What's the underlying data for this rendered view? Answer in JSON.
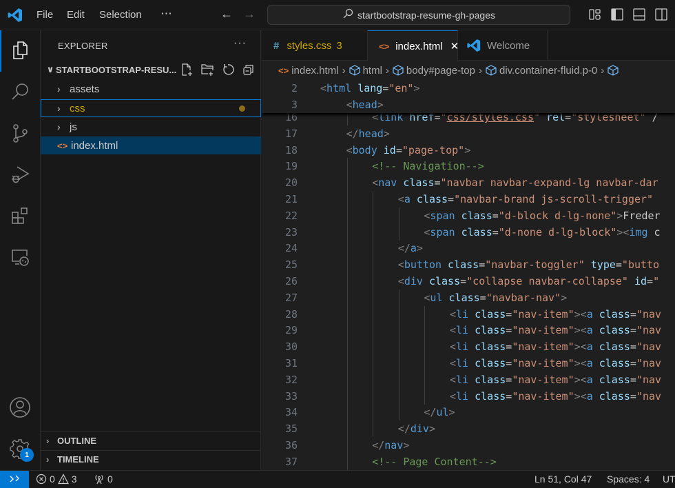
{
  "titlebar": {
    "menus": [
      "File",
      "Edit",
      "Selection",
      "⋯"
    ],
    "search_text": "startbootstrap-resume-gh-pages",
    "icons": [
      "vscode-logo",
      "arrow-left",
      "arrow-right",
      "customize-layout",
      "toggle-primary-sidebar",
      "toggle-panel",
      "toggle-secondary-sidebar"
    ]
  },
  "activity_bar": {
    "items": [
      "explorer",
      "search",
      "source-control",
      "run-and-debug",
      "extensions",
      "remote-explorer"
    ],
    "bottom": [
      "accounts",
      "manage"
    ],
    "manage_badge": "1",
    "accent": "#0078d4"
  },
  "sidebar": {
    "title": "EXPLORER",
    "more": "···",
    "folder": "STARTBOOTSTRAP-RESU...",
    "folder_actions": [
      "new-file",
      "new-folder",
      "refresh",
      "collapse-all"
    ],
    "tree": [
      {
        "label": "assets",
        "type": "folder"
      },
      {
        "label": "css",
        "type": "folder",
        "modified": true
      },
      {
        "label": "js",
        "type": "folder"
      },
      {
        "label": "index.html",
        "type": "file",
        "selected": true
      }
    ],
    "sections": [
      "OUTLINE",
      "TIMELINE"
    ]
  },
  "tabs": [
    {
      "icon": "#",
      "label": "styles.css",
      "badge": "3",
      "color": "#cca700"
    },
    {
      "icon": "<>",
      "label": "index.html",
      "active": true,
      "close": "✕"
    },
    {
      "icon": "vscode",
      "label": "Welcome"
    }
  ],
  "breadcrumb": [
    "index.html",
    "html",
    "body#page-top",
    "div.container-fluid.p-0",
    ""
  ],
  "sticky_lines": [
    {
      "n": "2",
      "tokens": [
        [
          "t",
          "<"
        ],
        [
          "tn",
          "html"
        ],
        [
          "tx",
          " "
        ],
        [
          "at",
          "lang"
        ],
        [
          "tx",
          "="
        ],
        [
          "av",
          "\"en\""
        ],
        [
          "t",
          ">"
        ]
      ],
      "indent": 0
    },
    {
      "n": "3",
      "tokens": [
        [
          "t",
          "<"
        ],
        [
          "tn",
          "head"
        ],
        [
          "t",
          ">"
        ]
      ],
      "indent": 1
    }
  ],
  "lines": [
    {
      "n": "16",
      "indent": 2,
      "tokens": [
        [
          "t",
          "<"
        ],
        [
          "tn",
          "link"
        ],
        [
          "tx",
          " "
        ],
        [
          "at",
          "href"
        ],
        [
          "tx",
          "="
        ],
        [
          "av",
          "\""
        ],
        [
          "av ul",
          "css/styles.css"
        ],
        [
          "av",
          "\""
        ],
        [
          "tx",
          " "
        ],
        [
          "at",
          "rel"
        ],
        [
          "tx",
          "="
        ],
        [
          "av",
          "\"stylesheet\""
        ],
        [
          "tx",
          " /"
        ]
      ]
    },
    {
      "n": "17",
      "indent": 1,
      "tokens": [
        [
          "t",
          "</"
        ],
        [
          "tn",
          "head"
        ],
        [
          "t",
          ">"
        ]
      ]
    },
    {
      "n": "18",
      "indent": 1,
      "tokens": [
        [
          "t",
          "<"
        ],
        [
          "tn",
          "body"
        ],
        [
          "tx",
          " "
        ],
        [
          "at",
          "id"
        ],
        [
          "tx",
          "="
        ],
        [
          "av",
          "\"page-top\""
        ],
        [
          "t",
          ">"
        ]
      ]
    },
    {
      "n": "19",
      "indent": 2,
      "tokens": [
        [
          "cm",
          "<!-- Navigation-->"
        ]
      ]
    },
    {
      "n": "20",
      "indent": 2,
      "tokens": [
        [
          "t",
          "<"
        ],
        [
          "tn",
          "nav"
        ],
        [
          "tx",
          " "
        ],
        [
          "at",
          "class"
        ],
        [
          "tx",
          "="
        ],
        [
          "av",
          "\"navbar navbar-expand-lg navbar-dar"
        ]
      ]
    },
    {
      "n": "21",
      "indent": 3,
      "tokens": [
        [
          "t",
          "<"
        ],
        [
          "tn",
          "a"
        ],
        [
          "tx",
          " "
        ],
        [
          "at",
          "class"
        ],
        [
          "tx",
          "="
        ],
        [
          "av",
          "\"navbar-brand js-scroll-trigger\""
        ]
      ]
    },
    {
      "n": "22",
      "indent": 4,
      "tokens": [
        [
          "t",
          "<"
        ],
        [
          "tn",
          "span"
        ],
        [
          "tx",
          " "
        ],
        [
          "at",
          "class"
        ],
        [
          "tx",
          "="
        ],
        [
          "av",
          "\"d-block d-lg-none\""
        ],
        [
          "t",
          ">"
        ],
        [
          "tx",
          "Freder"
        ]
      ]
    },
    {
      "n": "23",
      "indent": 4,
      "tokens": [
        [
          "t",
          "<"
        ],
        [
          "tn",
          "span"
        ],
        [
          "tx",
          " "
        ],
        [
          "at",
          "class"
        ],
        [
          "tx",
          "="
        ],
        [
          "av",
          "\"d-none d-lg-block\""
        ],
        [
          "t",
          ">"
        ],
        [
          "t",
          "<"
        ],
        [
          "tn",
          "img"
        ],
        [
          "tx",
          " c"
        ]
      ]
    },
    {
      "n": "24",
      "indent": 3,
      "tokens": [
        [
          "t",
          "</"
        ],
        [
          "tn",
          "a"
        ],
        [
          "t",
          ">"
        ]
      ]
    },
    {
      "n": "25",
      "indent": 3,
      "tokens": [
        [
          "t",
          "<"
        ],
        [
          "tn",
          "button"
        ],
        [
          "tx",
          " "
        ],
        [
          "at",
          "class"
        ],
        [
          "tx",
          "="
        ],
        [
          "av",
          "\"navbar-toggler\""
        ],
        [
          "tx",
          " "
        ],
        [
          "at",
          "type"
        ],
        [
          "tx",
          "="
        ],
        [
          "av",
          "\"butto"
        ]
      ]
    },
    {
      "n": "26",
      "indent": 3,
      "tokens": [
        [
          "t",
          "<"
        ],
        [
          "tn",
          "div"
        ],
        [
          "tx",
          " "
        ],
        [
          "at",
          "class"
        ],
        [
          "tx",
          "="
        ],
        [
          "av",
          "\"collapse navbar-collapse\""
        ],
        [
          "tx",
          " "
        ],
        [
          "at",
          "id"
        ],
        [
          "tx",
          "="
        ],
        [
          "av",
          "\""
        ]
      ]
    },
    {
      "n": "27",
      "indent": 4,
      "tokens": [
        [
          "t",
          "<"
        ],
        [
          "tn",
          "ul"
        ],
        [
          "tx",
          " "
        ],
        [
          "at",
          "class"
        ],
        [
          "tx",
          "="
        ],
        [
          "av",
          "\"navbar-nav\""
        ],
        [
          "t",
          ">"
        ]
      ]
    },
    {
      "n": "28",
      "indent": 5,
      "tokens": [
        [
          "t",
          "<"
        ],
        [
          "tn",
          "li"
        ],
        [
          "tx",
          " "
        ],
        [
          "at",
          "class"
        ],
        [
          "tx",
          "="
        ],
        [
          "av",
          "\"nav-item\""
        ],
        [
          "t",
          ">"
        ],
        [
          "t",
          "<"
        ],
        [
          "tn",
          "a"
        ],
        [
          "tx",
          " "
        ],
        [
          "at",
          "class"
        ],
        [
          "tx",
          "="
        ],
        [
          "av",
          "\"nav"
        ]
      ]
    },
    {
      "n": "29",
      "indent": 5,
      "tokens": [
        [
          "t",
          "<"
        ],
        [
          "tn",
          "li"
        ],
        [
          "tx",
          " "
        ],
        [
          "at",
          "class"
        ],
        [
          "tx",
          "="
        ],
        [
          "av",
          "\"nav-item\""
        ],
        [
          "t",
          ">"
        ],
        [
          "t",
          "<"
        ],
        [
          "tn",
          "a"
        ],
        [
          "tx",
          " "
        ],
        [
          "at",
          "class"
        ],
        [
          "tx",
          "="
        ],
        [
          "av",
          "\"nav"
        ]
      ]
    },
    {
      "n": "30",
      "indent": 5,
      "tokens": [
        [
          "t",
          "<"
        ],
        [
          "tn",
          "li"
        ],
        [
          "tx",
          " "
        ],
        [
          "at",
          "class"
        ],
        [
          "tx",
          "="
        ],
        [
          "av",
          "\"nav-item\""
        ],
        [
          "t",
          ">"
        ],
        [
          "t",
          "<"
        ],
        [
          "tn",
          "a"
        ],
        [
          "tx",
          " "
        ],
        [
          "at",
          "class"
        ],
        [
          "tx",
          "="
        ],
        [
          "av",
          "\"nav"
        ]
      ]
    },
    {
      "n": "31",
      "indent": 5,
      "tokens": [
        [
          "t",
          "<"
        ],
        [
          "tn",
          "li"
        ],
        [
          "tx",
          " "
        ],
        [
          "at",
          "class"
        ],
        [
          "tx",
          "="
        ],
        [
          "av",
          "\"nav-item\""
        ],
        [
          "t",
          ">"
        ],
        [
          "t",
          "<"
        ],
        [
          "tn",
          "a"
        ],
        [
          "tx",
          " "
        ],
        [
          "at",
          "class"
        ],
        [
          "tx",
          "="
        ],
        [
          "av",
          "\"nav"
        ]
      ]
    },
    {
      "n": "32",
      "indent": 5,
      "tokens": [
        [
          "t",
          "<"
        ],
        [
          "tn",
          "li"
        ],
        [
          "tx",
          " "
        ],
        [
          "at",
          "class"
        ],
        [
          "tx",
          "="
        ],
        [
          "av",
          "\"nav-item\""
        ],
        [
          "t",
          ">"
        ],
        [
          "t",
          "<"
        ],
        [
          "tn",
          "a"
        ],
        [
          "tx",
          " "
        ],
        [
          "at",
          "class"
        ],
        [
          "tx",
          "="
        ],
        [
          "av",
          "\"nav"
        ]
      ]
    },
    {
      "n": "33",
      "indent": 5,
      "tokens": [
        [
          "t",
          "<"
        ],
        [
          "tn",
          "li"
        ],
        [
          "tx",
          " "
        ],
        [
          "at",
          "class"
        ],
        [
          "tx",
          "="
        ],
        [
          "av",
          "\"nav-item\""
        ],
        [
          "t",
          ">"
        ],
        [
          "t",
          "<"
        ],
        [
          "tn",
          "a"
        ],
        [
          "tx",
          " "
        ],
        [
          "at",
          "class"
        ],
        [
          "tx",
          "="
        ],
        [
          "av",
          "\"nav"
        ]
      ]
    },
    {
      "n": "34",
      "indent": 4,
      "tokens": [
        [
          "t",
          "</"
        ],
        [
          "tn",
          "ul"
        ],
        [
          "t",
          ">"
        ]
      ]
    },
    {
      "n": "35",
      "indent": 3,
      "tokens": [
        [
          "t",
          "</"
        ],
        [
          "tn",
          "div"
        ],
        [
          "t",
          ">"
        ]
      ]
    },
    {
      "n": "36",
      "indent": 2,
      "tokens": [
        [
          "t",
          "</"
        ],
        [
          "tn",
          "nav"
        ],
        [
          "t",
          ">"
        ]
      ]
    },
    {
      "n": "37",
      "indent": 2,
      "tokens": [
        [
          "cm",
          "<!-- Page Content-->"
        ]
      ]
    }
  ],
  "statusbar": {
    "errors": "0",
    "warnings": "3",
    "ports": "0",
    "position": "Ln 51, Col 47",
    "spaces": "Spaces: 4",
    "encoding": "UT"
  }
}
